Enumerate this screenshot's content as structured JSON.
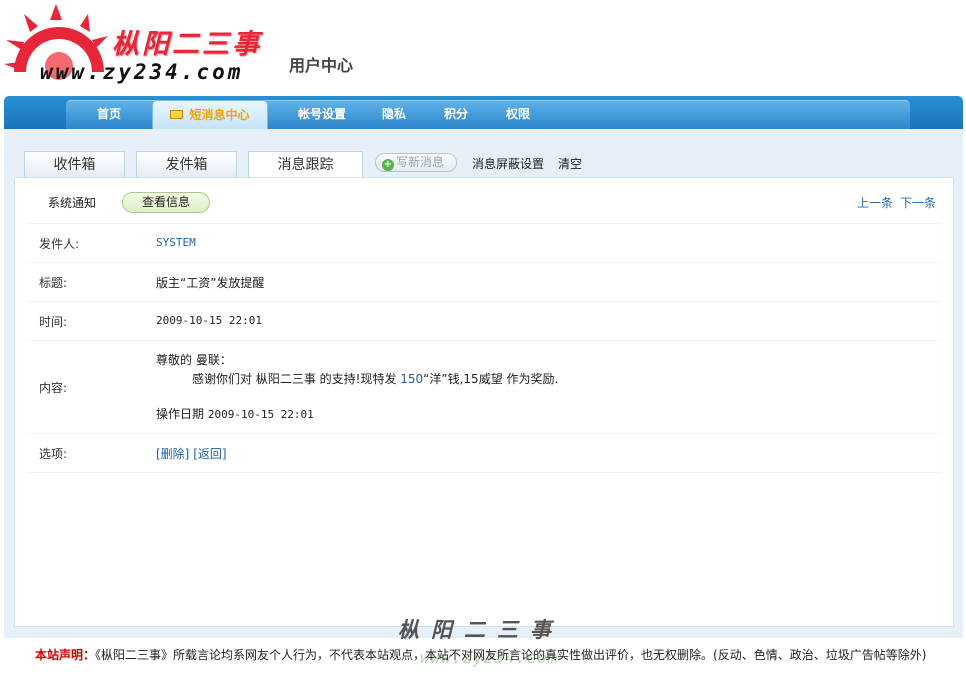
{
  "header": {
    "brand": "枞阳二三事",
    "url": "www.zy234.com",
    "section": "用户中心"
  },
  "nav": {
    "items": [
      {
        "label": "首页"
      },
      {
        "label": "短消息中心",
        "active": true,
        "icon": "mail-icon"
      },
      {
        "label": "帐号设置"
      },
      {
        "label": "隐私"
      },
      {
        "label": "积分"
      },
      {
        "label": "权限"
      }
    ]
  },
  "subtabs": {
    "inbox": "收件箱",
    "outbox": "发件箱",
    "track": "消息跟踪",
    "compose": "写新消息",
    "block_settings": "消息屏蔽设置",
    "clear": "清空"
  },
  "message": {
    "category": "系统通知",
    "view_button": "查看信息",
    "prev": "上一条",
    "next": "下一条",
    "sender_label": "发件人:",
    "sender": "SYSTEM",
    "subject_label": "标题:",
    "subject": "版主“工资”发放提醒",
    "time_label": "时间:",
    "time": "2009-10-15 22:01",
    "content_label": "内容:",
    "greeting": "尊敬的 曼联：",
    "body_prefix": "感谢你们对 枞阳二三事 的支持!现特发 ",
    "body_amount": "150",
    "body_suffix": "“洋”钱,15威望 作为奖励.",
    "op_date_label": "操作日期",
    "op_date": "2009-10-15 22:01",
    "options_label": "选项:",
    "delete": "[删除]",
    "back": "[返回]"
  },
  "footer": {
    "logo": "枞阳二三事",
    "url": "www.zy234.com",
    "notice_label": "本站声明：",
    "notice": "《枞阳二三事》所载言论均系网友个人行为，不代表本站观点，本站不对网友所言论的真实性做出评价，也无权删除。(反动、色情、政治、垃圾广告帖等除外)"
  },
  "colors": {
    "nav_blue": "#1a73bd",
    "brand_red": "#e8263a",
    "link_blue": "#1f5fa8",
    "active_tab_text": "#f5a400"
  }
}
